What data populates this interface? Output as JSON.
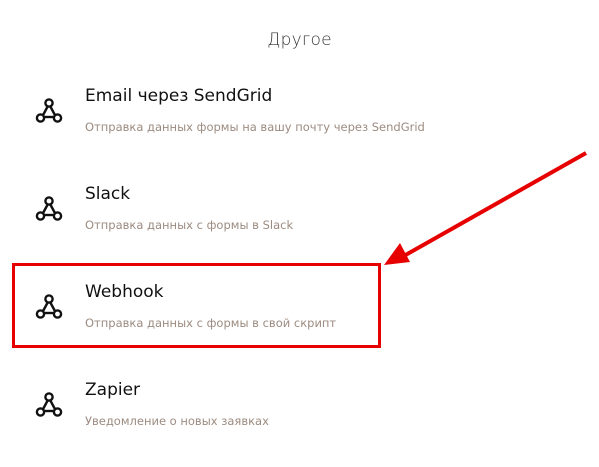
{
  "section": {
    "title": "Другое"
  },
  "integrations": [
    {
      "name": "Email через SendGrid",
      "description": "Отправка данных формы на вашу почту через SendGrid",
      "icon": "integration-nodes-icon"
    },
    {
      "name": "Slack",
      "description": "Отправка данных с формы в Slack",
      "icon": "integration-nodes-icon"
    },
    {
      "name": "Webhook",
      "description": "Отправка данных с формы в свой скрипт",
      "icon": "integration-nodes-icon"
    },
    {
      "name": "Zapier",
      "description": "Уведомление о новых заявках",
      "icon": "integration-nodes-icon"
    }
  ],
  "annotation": {
    "highlighted_item": "Webhook",
    "color": "#e60000"
  },
  "colors": {
    "text_primary": "#111111",
    "text_secondary": "#9c8b80",
    "accent_annotation": "#e60000"
  }
}
